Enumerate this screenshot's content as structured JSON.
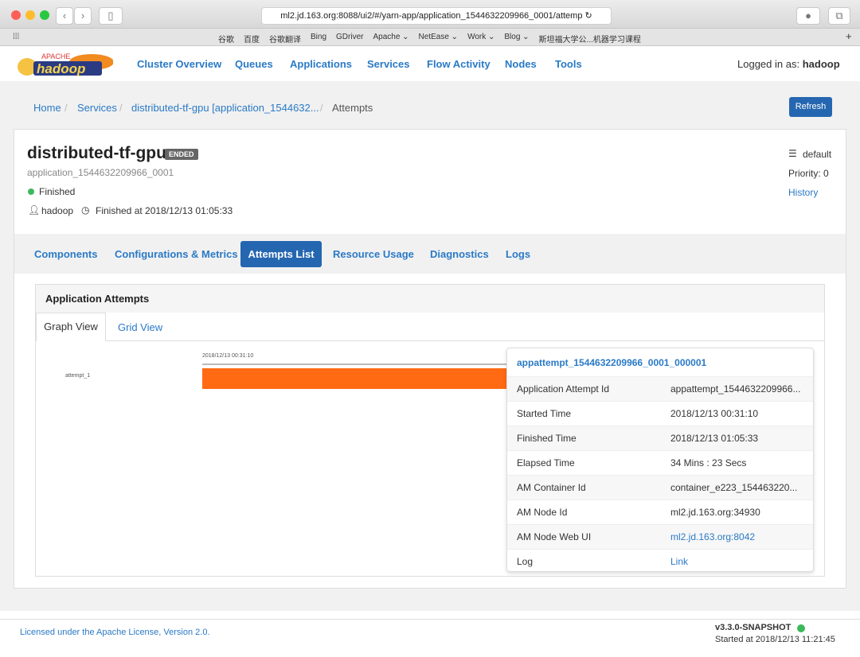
{
  "browser": {
    "url": "ml2.jd.163.org:8088/ui2/#/yarn-app/application_1544632209966_0001/attemp",
    "bookmarks": [
      "谷歌",
      "百度",
      "谷歌翻译",
      "Bing",
      "GDriver",
      "Apache ⌄",
      "NetEase ⌄",
      "Work ⌄",
      "Blog ⌄",
      "斯坦福大学公...机器学习课程"
    ]
  },
  "nav": {
    "logo_text": "hadoop",
    "logo_sub": "APACHE",
    "links": [
      "Cluster Overview",
      "Queues",
      "Applications",
      "Services",
      "Flow Activity",
      "Nodes",
      "Tools"
    ],
    "logged_in_label": "Logged in as:",
    "user": "hadoop"
  },
  "breadcrumb": [
    "Home",
    "Services",
    "distributed-tf-gpu [application_1544632...",
    "Attempts"
  ],
  "refresh_label": "Refresh",
  "app": {
    "name": "distributed-tf-gpu",
    "badge": "ENDED",
    "id": "application_1544632209966_0001",
    "status": "Finished",
    "user": "hadoop",
    "finished": "Finished at 2018/12/13 01:05:33",
    "queue": "default",
    "priority": "Priority: 0",
    "history": "History"
  },
  "tabs": [
    "Components",
    "Configurations & Metrics",
    "Attempts List",
    "Resource Usage",
    "Diagnostics",
    "Logs"
  ],
  "panel": {
    "title": "Application Attempts",
    "subtabs": [
      "Graph View",
      "Grid View"
    ]
  },
  "chart": {
    "start_label": "2018/12/13 00:31:10",
    "attempt_label": "attempt_1",
    "bar_color": "#ff6a13"
  },
  "info": {
    "title": "appattempt_1544632209966_0001_000001",
    "rows": [
      {
        "k": "Application Attempt Id",
        "v": "appattempt_1544632209966..."
      },
      {
        "k": "Started Time",
        "v": "2018/12/13 00:31:10"
      },
      {
        "k": "Finished Time",
        "v": "2018/12/13 01:05:33"
      },
      {
        "k": "Elapsed Time",
        "v": "34 Mins : 23 Secs"
      },
      {
        "k": "AM Container Id",
        "v": "container_e223_154463220..."
      },
      {
        "k": "AM Node Id",
        "v": "ml2.jd.163.org:34930"
      },
      {
        "k": "AM Node Web UI",
        "v": "ml2.jd.163.org:8042"
      },
      {
        "k": "Log",
        "v": "Link"
      }
    ]
  },
  "footer": {
    "license": "Licensed under the Apache License, Version 2.0.",
    "version": "v3.3.0-SNAPSHOT",
    "started": "Started at 2018/12/13 11:21:45"
  }
}
